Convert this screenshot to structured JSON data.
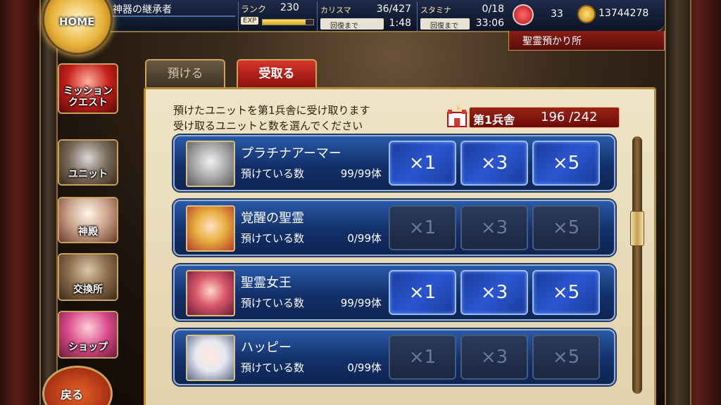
{
  "header": {
    "home_label": "HOME",
    "player_name": "神器の継承者",
    "rank_label": "ランク",
    "rank_value": "230",
    "exp_label": "EXP",
    "exp_progress": 0.85,
    "charisma_label": "カリスマ",
    "charisma_value": "36/427",
    "charisma_recover_label": "回復まで",
    "charisma_recover_time": "1:48",
    "stamina_label": "スタミナ",
    "stamina_value": "0/18",
    "stamina_recover_label": "回復まで",
    "stamina_recover_time": "33:06",
    "crystals": "33",
    "gold": "13744278",
    "location": "聖霊預かり所"
  },
  "sidebar": {
    "items": [
      {
        "label": "ミッション\nクエスト"
      },
      {
        "label": "ユニット"
      },
      {
        "label": "神殿"
      },
      {
        "label": "交換所"
      },
      {
        "label": "ショップ"
      }
    ],
    "back_label": "戻る"
  },
  "tabs": [
    {
      "label": "預ける",
      "active": false
    },
    {
      "label": "受取る",
      "active": true
    }
  ],
  "panel": {
    "description_line1": "預けたユニットを第1兵舎に受け取ります",
    "description_line2": "受け取るユニットと数を選んでください",
    "barracks_label": "第1兵舎",
    "barracks_count": "196 /242"
  },
  "units": [
    {
      "name": "プラチナアーマー",
      "count_label": "預けている数",
      "count": "99/99体",
      "enabled": true
    },
    {
      "name": "覚醒の聖霊",
      "count_label": "預けている数",
      "count": "0/99体",
      "enabled": false
    },
    {
      "name": "聖霊女王",
      "count_label": "預けている数",
      "count": "99/99体",
      "enabled": true
    },
    {
      "name": "ハッピー",
      "count_label": "預けている数",
      "count": "0/99体",
      "enabled": false
    }
  ],
  "buttons": {
    "x1": "×1",
    "x3": "×3",
    "x5": "×5"
  },
  "colors": {
    "accent_red": "#d8342a",
    "panel_bg": "#efe4c6",
    "row_blue": "#12306a",
    "button_blue": "#2a56d0"
  }
}
